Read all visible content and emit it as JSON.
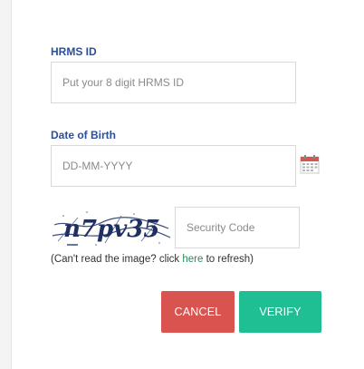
{
  "form": {
    "hrms_label": "HRMS ID",
    "hrms_placeholder": "Put your 8 digit HRMS ID",
    "dob_label": "Date of Birth",
    "dob_placeholder": "DD-MM-YYYY",
    "captcha_text": "n7pv35",
    "security_code_placeholder": "Security Code",
    "refresh_prefix": "(Can't read the image? click ",
    "refresh_link": "here",
    "refresh_suffix": " to refresh)",
    "cancel_label": "CANCEL",
    "verify_label": "VERIFY"
  },
  "colors": {
    "label": "#2b4f9a",
    "cancel": "#d9534f",
    "verify": "#1fbf93",
    "link": "#2c8a5d",
    "calendar": "#d9534f"
  },
  "icons": {
    "calendar": "calendar-icon"
  }
}
